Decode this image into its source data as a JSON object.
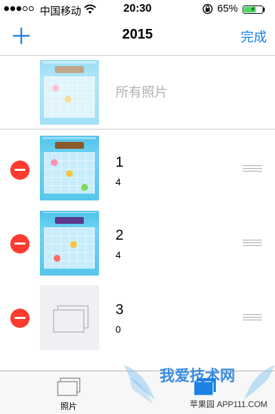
{
  "status_bar": {
    "carrier": "中国移动",
    "time": "20:30",
    "battery_percent": "65%",
    "battery_level": 0.65,
    "icons": [
      "signal-dots-icon",
      "wifi-icon",
      "rotation-lock-icon",
      "battery-charging-icon"
    ]
  },
  "nav": {
    "add_icon": "plus-icon",
    "title": "2015",
    "done_label": "完成",
    "accent_color": "#1a82e2"
  },
  "all_photos": {
    "label": "所有照片"
  },
  "albums": [
    {
      "name": "1",
      "count": "4",
      "thumbnail": "game-screenshot"
    },
    {
      "name": "2",
      "count": "4",
      "thumbnail": "game-screenshot"
    },
    {
      "name": "3",
      "count": "0",
      "thumbnail": "empty-album-placeholder"
    }
  ],
  "colors": {
    "delete_red": "#ff3b30",
    "separator": "#c8c7cc",
    "placeholder_gray": "#b2b2b2"
  },
  "tab_bar": {
    "tabs": [
      {
        "label": "照片",
        "icon": "photos-stack-icon",
        "selected": false
      },
      {
        "label": "",
        "icon": "albums-icon",
        "selected": true
      }
    ]
  },
  "watermark": {
    "title": "我爱技术网",
    "subtitle": "苹果园 APP111.COM"
  }
}
